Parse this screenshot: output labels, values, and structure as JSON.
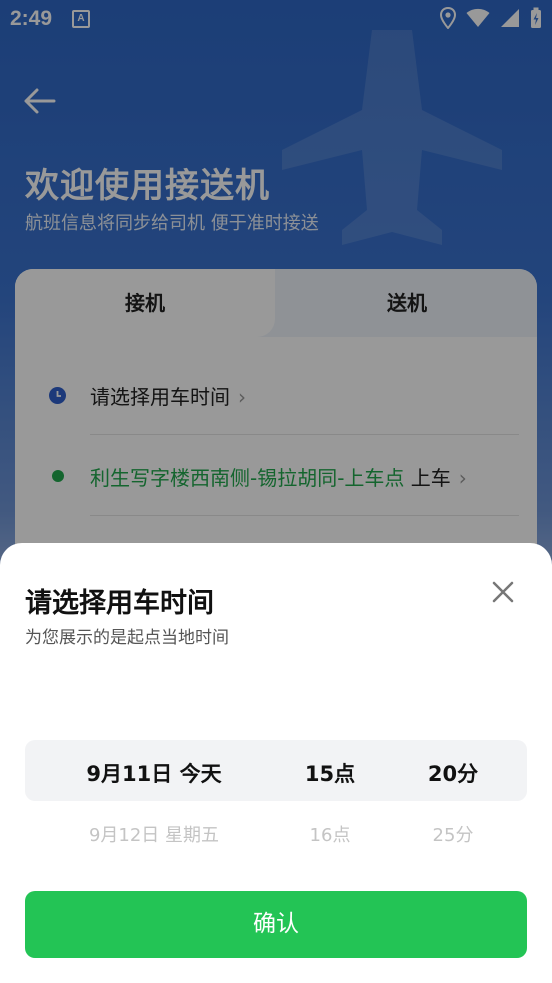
{
  "status_bar": {
    "time": "2:49",
    "a_icon": "A"
  },
  "header": {
    "title": "欢迎使用接送机",
    "subtitle": "航班信息将同步给司机 便于准时接送"
  },
  "tabs": [
    {
      "label": "接机",
      "active": true
    },
    {
      "label": "送机",
      "active": false
    }
  ],
  "form": {
    "time_row": {
      "label": "请选择用车时间",
      "icon": "clock-icon",
      "icon_color": "#2f5fcc"
    },
    "pickup_row": {
      "location": "利生写字楼西南侧-锡拉胡同-上车点",
      "suffix": "上车",
      "icon": "green-dot-icon",
      "color": "#22a84e"
    }
  },
  "sheet": {
    "title": "请选择用车时间",
    "subtitle": "为您展示的是起点当地时间",
    "close_icon": "close-icon",
    "picker": {
      "selected": {
        "date": "9月11日 今天",
        "hour": "15点",
        "minute": "20分"
      },
      "next": {
        "date": "9月12日 星期五",
        "hour": "16点",
        "minute": "25分"
      }
    },
    "confirm_label": "确认",
    "confirm_color": "#23c455"
  }
}
